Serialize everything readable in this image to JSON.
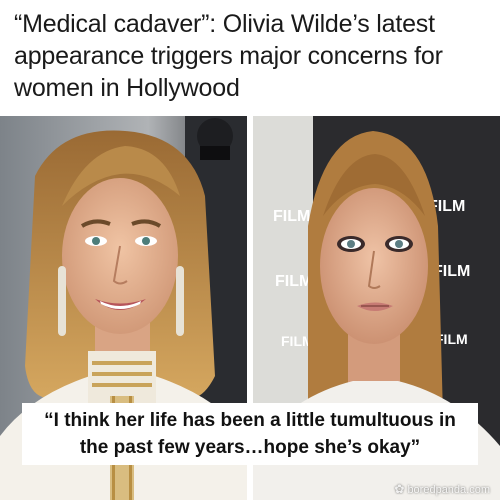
{
  "headline": "“Medical cadaver”: Olivia Wilde’s latest appearance triggers major concerns for women in Hollywood",
  "quote": "“I think her life has been a little tumultuous in the past few years…hope she’s okay”",
  "backdrop_logo": "FILM",
  "watermark": "boredpanda.com",
  "colors": {
    "left_background": "#8a8f94",
    "right_backdrop": "#2b2b2e",
    "hair": "#b98a4a",
    "skin": "#e3b596",
    "dress_white": "#f4f1ea",
    "embroidery_gold": "#c9a35a"
  }
}
